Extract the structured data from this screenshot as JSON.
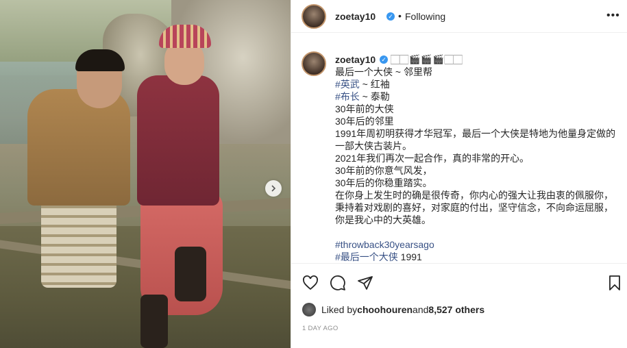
{
  "post": {
    "username": "zoetay10",
    "follow_status": "Following",
    "header_dot": "•",
    "more_icon": "•••"
  },
  "caption": {
    "username": "zoetay10",
    "emojis": "🏻🏻🎬🎬🎬🏻🏻",
    "lines": [
      {
        "text": "最后一个大侠 ~ 邻里帮"
      },
      {
        "tag": "#英武",
        "text": " ~ 红袖"
      },
      {
        "tag": "#布长",
        "text": " ~ 泰勒"
      },
      {
        "text": "30年前的大侠"
      },
      {
        "text": "30年后的邻里"
      },
      {
        "text": "1991年周初明获得才华冠军，最后一个大侠是特地为他量身定做的一部大侠古装片。"
      },
      {
        "text": "2021年我们再次一起合作，真的非常的开心。"
      },
      {
        "text": "30年前的你意气风发，"
      },
      {
        "text": "30年后的你稳重踏实。"
      },
      {
        "text": "在你身上发生时的确是很传奇，你内心的强大让我由衷的佩服你，秉持着对戏剧的喜好，对家庭的付出，坚守信念，不向命运屈服，你是我心中的大英雄。"
      }
    ],
    "hashtag1": "#throwback30yearsago",
    "hashtag2": "#最后一个大侠",
    "hashtag2_suffix": " 1991"
  },
  "likes": {
    "prefix": "Liked by ",
    "user": "choohouren",
    "middle": " and ",
    "count": "8,527 others"
  },
  "time_ago": "1 DAY AGO",
  "icons": {
    "like": "heart-icon",
    "comment": "comment-icon",
    "share": "send-icon",
    "save": "bookmark-icon",
    "next": "chevron-right-icon"
  },
  "colors": {
    "link": "#00376b",
    "verified": "#3897f0",
    "meta": "#8e8e8e"
  }
}
